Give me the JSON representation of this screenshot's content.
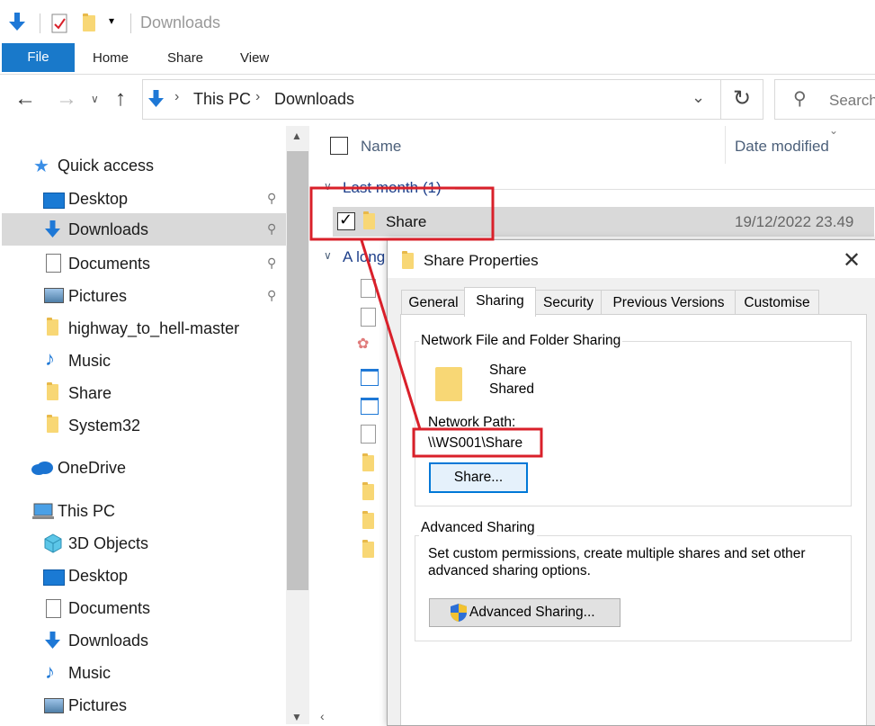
{
  "quick_toolbar": {
    "title": "Downloads"
  },
  "ribbon": {
    "tabs": [
      "File",
      "Home",
      "Share",
      "View"
    ]
  },
  "address": {
    "crumbs": [
      "This PC",
      "Downloads"
    ],
    "search_placeholder": "Search"
  },
  "nav": {
    "quick_access": "Quick access",
    "quick_items": [
      "Desktop",
      "Downloads",
      "Documents",
      "Pictures",
      "highway_to_hell-master",
      "Music",
      "Share",
      "System32"
    ],
    "onedrive": "OneDrive",
    "this_pc": "This PC",
    "pc_items": [
      "3D Objects",
      "Desktop",
      "Documents",
      "Downloads",
      "Music",
      "Pictures"
    ]
  },
  "files": {
    "col_name": "Name",
    "col_date": "Date modified",
    "group1": "Last month (1)",
    "row_name": "Share",
    "row_date": "19/12/2022 23.49",
    "group2": "A long"
  },
  "dialog": {
    "title": "Share Properties",
    "tabs": [
      "General",
      "Sharing",
      "Security",
      "Previous Versions",
      "Customise"
    ],
    "nfs_legend": "Network File and Folder Sharing",
    "folder_name": "Share",
    "folder_status": "Shared",
    "path_label": "Network Path:",
    "path_value": "\\\\WS001\\Share",
    "share_button": "Share...",
    "adv_legend": "Advanced Sharing",
    "adv_desc_1": "Set custom permissions, create multiple shares and set other",
    "adv_desc_2": "advanced sharing options.",
    "adv_button": "Advanced Sharing..."
  },
  "colors": {
    "accent": "#0078d7",
    "highlight_red": "#d9202a",
    "selection": "#d9d9d9"
  }
}
